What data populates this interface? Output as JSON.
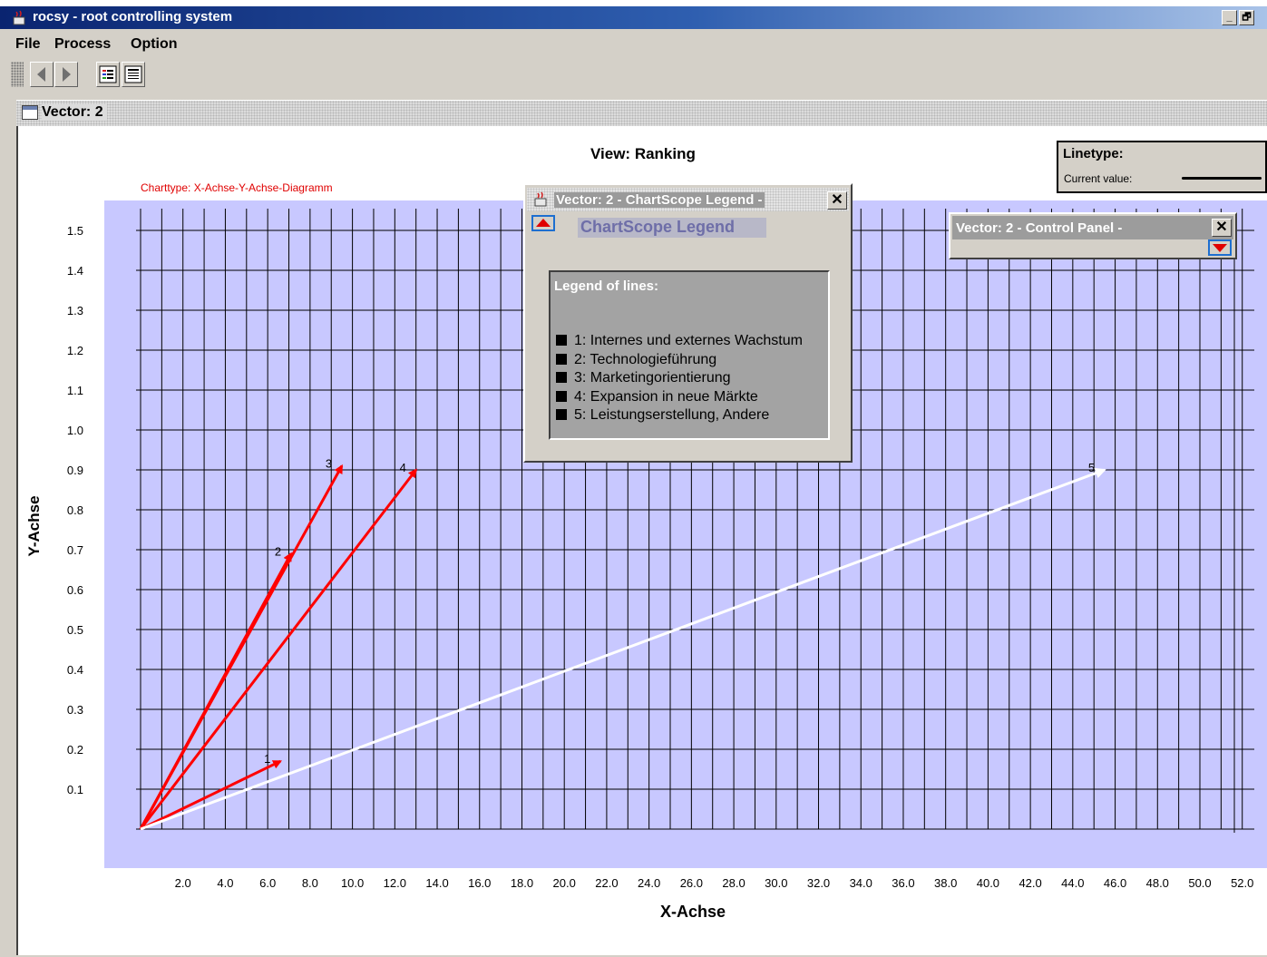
{
  "window": {
    "title": "rocsy - root controlling system",
    "minimize_label": "_",
    "restore_label": "🗗"
  },
  "menu": {
    "file": "File",
    "process": "Process",
    "option": "Option"
  },
  "toolbar": {
    "icons": [
      "back-arrow-icon",
      "forward-arrow-icon",
      "list-view-icon",
      "detail-view-icon"
    ]
  },
  "internal_frame": {
    "title": "Vector: 2"
  },
  "linetype_panel": {
    "heading": "Linetype:",
    "current_value_label": "Current value:"
  },
  "legend_window": {
    "title": "Vector: 2   - ChartScope Legend -",
    "close_label": "✕",
    "heading": "ChartScope Legend",
    "box_title": "Legend of lines:",
    "items": [
      "1: Internes und externes Wachstum",
      "2: Technologieführung",
      "3: Marketingorientierung",
      "4: Expansion in neue Märkte",
      "5: Leistungserstellung, Andere"
    ]
  },
  "control_panel": {
    "title": "Vector: 2   - Control Panel -",
    "close_label": "✕"
  },
  "colors": {
    "plot_background": "#c8c8ff",
    "vector_red": "#ff0000",
    "vector_white": "#ffffff",
    "charttype_text": "#e00000"
  },
  "chart_data": {
    "type": "line",
    "title": "View: Ranking",
    "subtitle": "Charttype: X-Achse-Y-Achse-Diagramm",
    "xlabel": "X-Achse",
    "ylabel": "Y-Achse",
    "xlim": [
      0,
      52
    ],
    "ylim": [
      0,
      1.6
    ],
    "grid": true,
    "xticks": [
      "2.0",
      "4.0",
      "6.0",
      "8.0",
      "10.0",
      "12.0",
      "14.0",
      "16.0",
      "18.0",
      "20.0",
      "22.0",
      "24.0",
      "26.0",
      "28.0",
      "30.0",
      "32.0",
      "34.0",
      "36.0",
      "38.0",
      "40.0",
      "42.0",
      "44.0",
      "46.0",
      "48.0",
      "50.0",
      "52.0"
    ],
    "yticks": [
      "0.1",
      "0.2",
      "0.3",
      "0.4",
      "0.5",
      "0.6",
      "0.7",
      "0.8",
      "0.9",
      "1.0",
      "1.1",
      "1.2",
      "1.3",
      "1.4",
      "1.5"
    ],
    "series": [
      {
        "label": "1",
        "x": [
          0,
          6.6
        ],
        "y": [
          0,
          0.17
        ],
        "color": "#ff0000"
      },
      {
        "label": "2",
        "x": [
          0,
          7.1
        ],
        "y": [
          0,
          0.69
        ],
        "color": "#ff0000"
      },
      {
        "label": "3",
        "x": [
          0,
          9.5
        ],
        "y": [
          0,
          0.91
        ],
        "color": "#ff0000"
      },
      {
        "label": "4",
        "x": [
          0,
          13.0
        ],
        "y": [
          0,
          0.9
        ],
        "color": "#ff0000"
      },
      {
        "label": "5",
        "x": [
          0,
          45.5
        ],
        "y": [
          0,
          0.9
        ],
        "color": "#ffffff"
      }
    ]
  }
}
